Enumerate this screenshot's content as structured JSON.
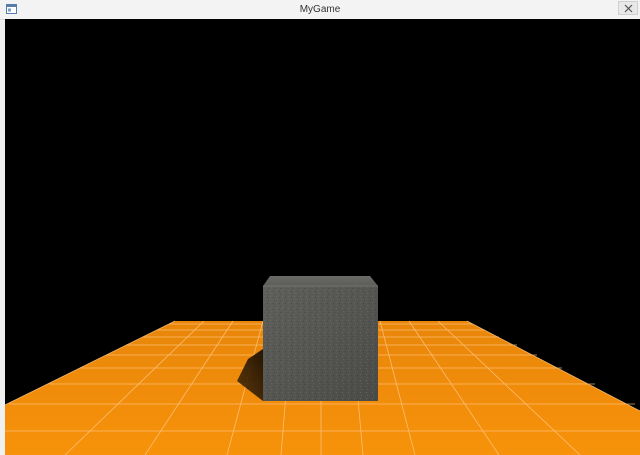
{
  "window": {
    "title": "MyGame",
    "icon": "app-window-icon",
    "close_icon": "close-icon"
  },
  "scene": {
    "background_color": "#000000",
    "floor_color": "#f28c08",
    "grid_line_color": "#ffc27a",
    "cube_color": "#5a5a58",
    "shadow_color": "#2a1a05"
  }
}
